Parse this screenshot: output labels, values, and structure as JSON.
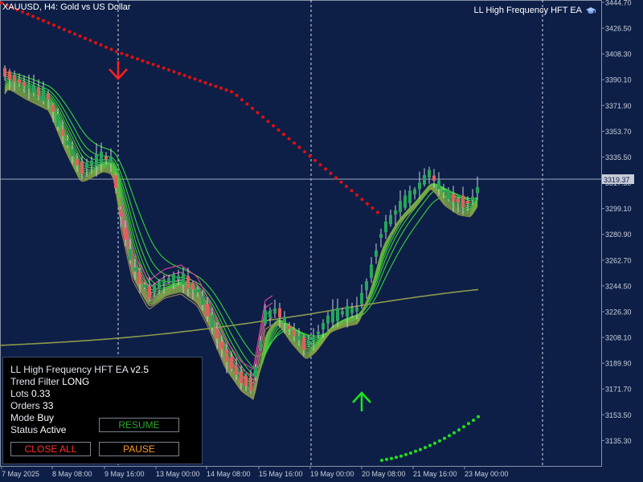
{
  "header": {
    "symbol_title": "XAUUSD, H4:  Gold vs US Dollar",
    "ea_badge": "LL High Frequency HFT EA",
    "ea_badge_icon": "graduation-cap-icon"
  },
  "chart_data": {
    "type": "candlestick",
    "title": "XAUUSD, H4:  Gold vs US Dollar",
    "current_price_label": "3319.37",
    "ylim": [
      3123.5,
      3444.7
    ],
    "price_ticks": [
      "3444.70",
      "3426.50",
      "3408.30",
      "3390.10",
      "3371.90",
      "3353.70",
      "3335.50",
      "3317.30",
      "3299.10",
      "3280.90",
      "3262.70",
      "3244.50",
      "3226.30",
      "3208.10",
      "3189.90",
      "3171.70",
      "3153.50",
      "3135.30"
    ],
    "time_ticks": [
      "7 May 2025",
      "8 May 08:00",
      "9 May 16:00",
      "13 May 00:00",
      "14 May 08:00",
      "15 May 16:00",
      "19 May 00:00",
      "20 May 08:00",
      "21 May 16:00",
      "23 May 00:00"
    ],
    "grid": "period-separators",
    "period_separators": [
      "9 May 16:00",
      "19 May 00:00"
    ],
    "signals": [
      {
        "type": "sell",
        "icon": "arrow-down-icon",
        "color": "#ff2020",
        "at": "9 May"
      },
      {
        "type": "buy",
        "icon": "arrow-up-icon",
        "color": "#19e619",
        "at": "20 May"
      }
    ],
    "colors": {
      "bull": "#26a65b",
      "bear": "#e06060",
      "wick": "#c8cdd8",
      "sell_dots": "#e01010",
      "buy_dots": "#20e020",
      "background": "#0d1f47"
    }
  },
  "panel": {
    "title": "LL High Frequency HFT EA",
    "version": "v2.5",
    "trend_label": "Trend Filter",
    "trend_value": "LONG",
    "lots_label": "Lots",
    "lots_value": "0.33",
    "orders_label": "Orders",
    "orders_value": "33",
    "mode_label": "Mode",
    "mode_value": "Buy",
    "status_label": "Status",
    "status_value": "Active",
    "resume_label": "RESUME",
    "close_all_label": "CLOSE ALL",
    "pause_label": "PAUSE",
    "resume_color": "#2aa42a",
    "close_all_color": "#ff3030",
    "pause_color": "#ff9a2a"
  }
}
